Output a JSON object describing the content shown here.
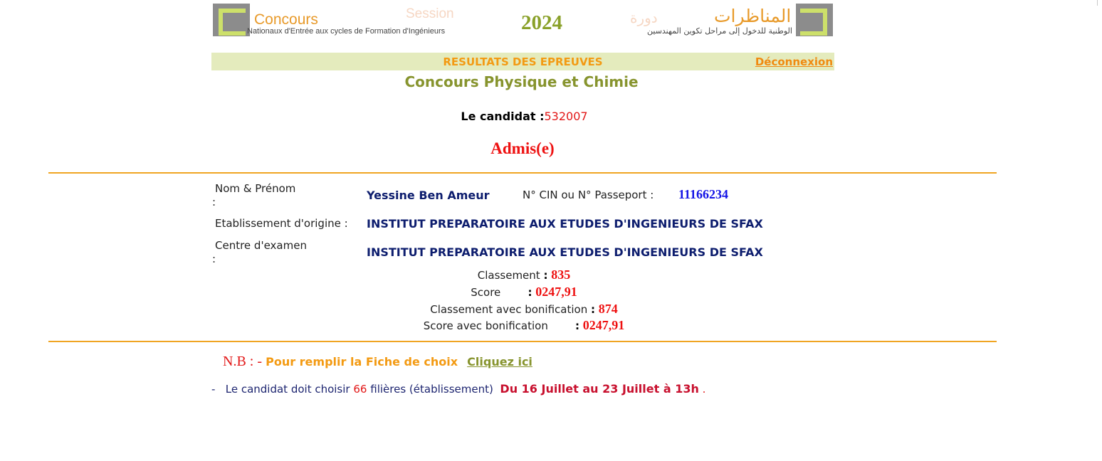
{
  "header": {
    "concours_fr": "Concours",
    "concours_fr_sub": "Nationaux d'Entrée aux cycles de Formation d'Ingénieurs",
    "session_fr": "Session",
    "year": "2024",
    "session_ar": "دورة",
    "concours_ar": "المناظرات",
    "concours_ar_sub": "الوطنية للدخول إلى مراحل تكوين المهندسين"
  },
  "results_bar": {
    "title": "RESULTATS DES EPREUVES",
    "logout": "Déconnexion"
  },
  "concours_title": "Concours Physique et Chimie",
  "candidat": {
    "label": "Le candidat :",
    "number": "532007",
    "status": "Admis(e)"
  },
  "info": {
    "name_label": "Nom & Prénom",
    "name_colon": ":",
    "name_value": "Yessine Ben Ameur",
    "cin_label": "N° CIN ou N° Passeport :",
    "cin_value": "11166234",
    "etab_label": "Etablissement d'origine :",
    "etab_value": "INSTITUT PREPARATOIRE AUX ETUDES D'INGENIEURS DE SFAX",
    "centre_label": "Centre d'examen",
    "centre_colon": ":",
    "centre_value": "INSTITUT PREPARATOIRE AUX ETUDES D'INGENIEURS DE SFAX"
  },
  "stats": {
    "classement_label": "Classement",
    "classement_value": "835",
    "score_label": "Score",
    "score_value": "0247,91",
    "classement_bonif_label": "Classement avec bonification",
    "classement_bonif_value": "874",
    "score_bonif_label": "Score avec bonification",
    "score_bonif_value": "0247,91",
    "colon": ":"
  },
  "nb": {
    "label": "N.B : -",
    "text": "Pour remplir la Fiche de choix",
    "link": "Cliquez ici"
  },
  "note": {
    "dash": "-",
    "text1": "Le candidat doit  choisir",
    "count": "66",
    "text2": "filières (établissement)",
    "dates": "Du 16 Juillet au 23 Juillet à 13h",
    "end": "."
  },
  "colors": {
    "orange": "#f39a12",
    "olive": "#87942e",
    "red": "#ee1111",
    "navy": "#0d1d6e",
    "rule": "#f0a522"
  }
}
